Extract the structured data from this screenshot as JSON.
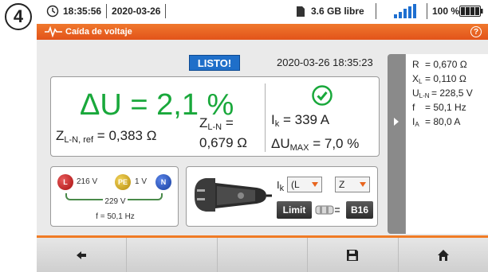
{
  "step_badge": "4",
  "status": {
    "time": "18:35:56",
    "date": "2020-03-26",
    "storage": "3.6 GB libre",
    "battery": "100 %"
  },
  "title": "Caída de voltaje",
  "status_label": "LISTO!",
  "timestamp": "2020-03-26 18:35:23",
  "main_result": {
    "du_label": "ΔU = ",
    "du_value": "2,1 %",
    "zref_label": "Z",
    "zref_sub": "L-N, ref",
    "zref_value": " = 0,383 Ω",
    "zln_label": "Z",
    "zln_sub": "L-N",
    "zln_eq": " =",
    "zln_value": "0,679 Ω",
    "ik_label": "I",
    "ik_sub": "k",
    "ik_value": " = 339 A",
    "dumax_label": "ΔU",
    "dumax_sub": "MAX",
    "dumax_value": " = 7,0 %"
  },
  "phase": {
    "l_label": "L",
    "pe_label": "PE",
    "n_label": "N",
    "l_pe_voltage": "216 V",
    "pe_n_voltage": "1 V",
    "l_n_voltage": "229 V",
    "frequency": "f = 50,1 Hz"
  },
  "device": {
    "ik_label": "I",
    "ik_sub": "k",
    "select1_value": "(L",
    "select2_value": "Z",
    "limit_label": "Limit",
    "fuse_value": "B16"
  },
  "side_panel": {
    "rows": [
      {
        "label": "R",
        "sub": "",
        "value": "= 0,670 Ω"
      },
      {
        "label": "X",
        "sub": "L",
        "value": "= 0,110 Ω"
      },
      {
        "label": "U",
        "sub": "L-N",
        "value": "= 228,5 V"
      },
      {
        "label": "f",
        "sub": "",
        "value": "= 50,1 Hz"
      },
      {
        "label": "I",
        "sub": "A",
        "value": "= 80,0 A"
      }
    ]
  },
  "colors": {
    "accent_orange": "#e8651e",
    "result_green": "#19a83b",
    "listo_blue": "#1f6fc9"
  },
  "toolbar_icons": [
    "back-arrow-icon",
    "save-icon",
    "home-icon"
  ]
}
